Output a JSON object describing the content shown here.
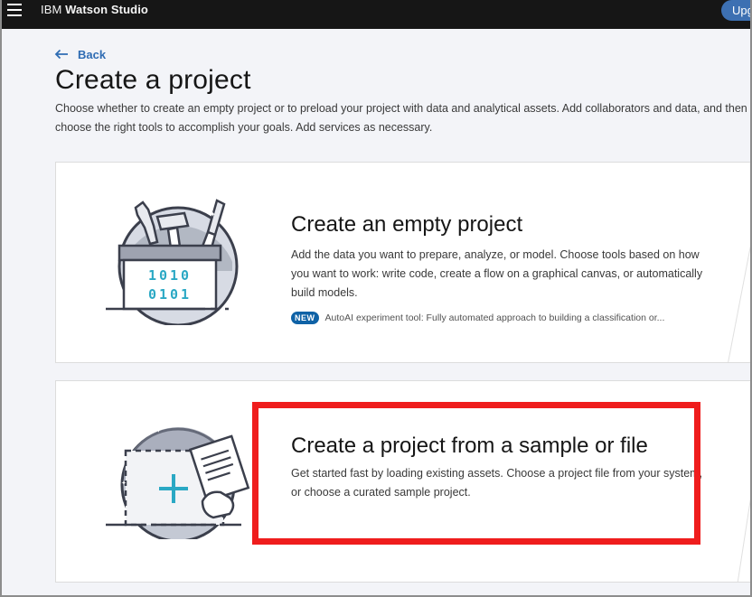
{
  "app": {
    "brand_prefix": "IBM",
    "brand_name": "Watson Studio",
    "upgrade_label": "Upg"
  },
  "nav": {
    "back_label": "Back"
  },
  "page": {
    "title": "Create a project",
    "description": "Choose whether to create an empty project or to preload your project with data and analytical assets. Add collaborators and data, and then choose the right tools to accomplish your goals. Add services as necessary."
  },
  "cards": [
    {
      "title": "Create an empty project",
      "description": "Add the data you want to prepare, analyze, or model. Choose tools based on how you want to work: write code, create a flow on a graphical canvas, or automatically build models.",
      "badge": "NEW",
      "badge_text": "AutoAI experiment tool: Fully automated approach to building a classification or...",
      "illustration_text": [
        "1010",
        "0101"
      ],
      "icon": "toolbox-icon"
    },
    {
      "title": "Create a project from a sample or file",
      "description": "Get started fast by loading existing assets. Choose a project file from your system, or choose a curated sample project.",
      "icon": "import-file-icon"
    }
  ],
  "colors": {
    "topbar": "#161616",
    "accent": "#2f6cb3",
    "badge": "#0f62a6",
    "highlight": "#ef1d1d",
    "illustration_teal": "#2aa8c4"
  }
}
